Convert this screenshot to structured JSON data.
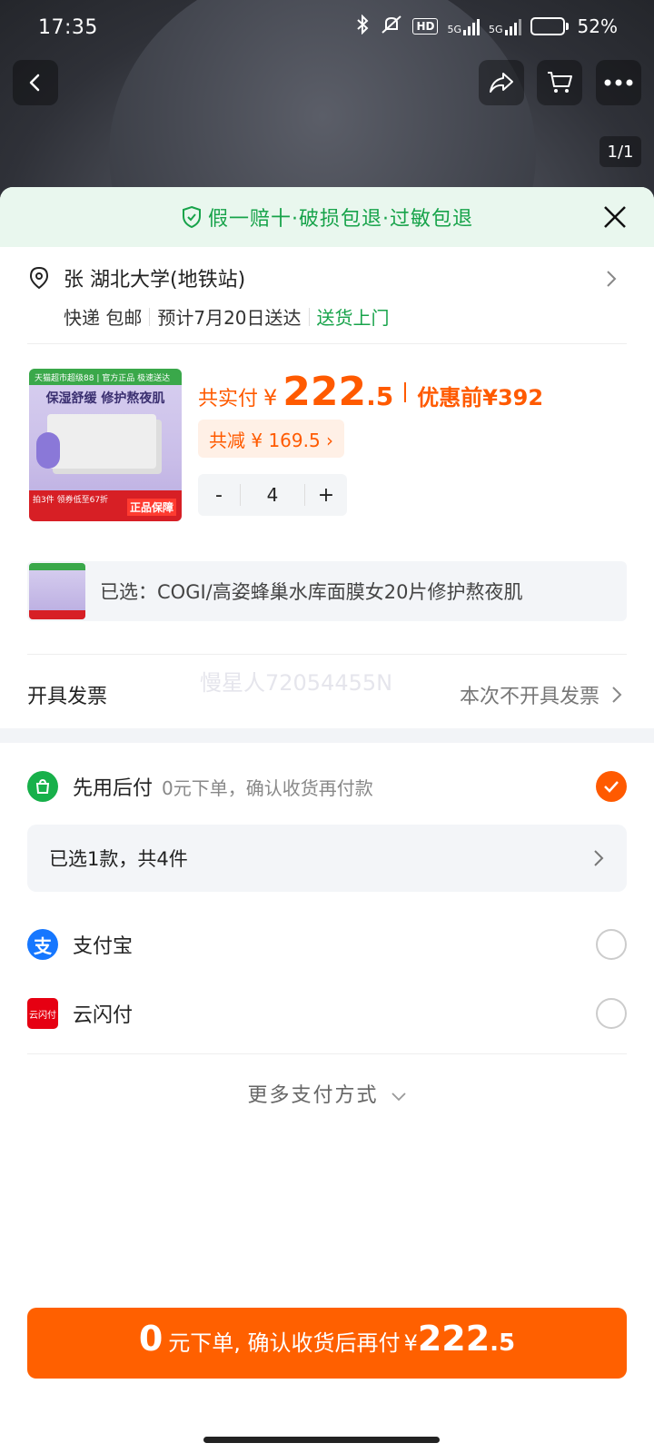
{
  "status_bar": {
    "time": "17:35",
    "hd_label": "HD",
    "net1": "5G",
    "net2": "5G",
    "battery_percent_text": "52%",
    "battery_level": 0.52
  },
  "gallery": {
    "counter": "1/1"
  },
  "guarantee": {
    "text": "假一赔十·破损包退·过敏包退"
  },
  "address": {
    "line": "张 湖北大学(地铁站)",
    "shipping": "快递 包邮",
    "eta": "预计7月20日送达",
    "delivery": "送货上门"
  },
  "product": {
    "thumb_top": "天猫超市超级88 | 官方正品 极速送达",
    "thumb_title": "保湿舒缓 修护熬夜肌",
    "thumb_promo": "拍3件 领券低至67折",
    "thumb_badge": "正品保障",
    "total_label": "共实付",
    "currency": "¥",
    "price_int": "222",
    "price_dec": ".5",
    "before_label": "优惠前",
    "before_price": "¥392",
    "discount": "共减 ¥ 169.5 ›",
    "qty_minus": "-",
    "qty": "4",
    "qty_plus": "+"
  },
  "selected": {
    "text": "已选：COGI/高姿蜂巢水库面膜女20片修护熬夜肌"
  },
  "invoice": {
    "label": "开具发票",
    "value": "本次不开具发票",
    "watermark": "慢星人72054455N"
  },
  "payment": {
    "pay_later_name": "先用后付",
    "pay_later_desc": "0元下单，确认收货再付款",
    "summary": "已选1款，共4件",
    "alipay": "支付宝",
    "alipay_glyph": "支",
    "unionpay": "云闪付",
    "unionpay_glyph": "云闪付",
    "more": "更多支付方式"
  },
  "submit": {
    "zero": "0",
    "text": "元下单, 确认收货后再付",
    "currency": "¥",
    "price_int": "222",
    "price_dec": ".5"
  },
  "colors": {
    "accent": "#ff6000",
    "green": "#17a34a",
    "price": "#ff5a00"
  }
}
